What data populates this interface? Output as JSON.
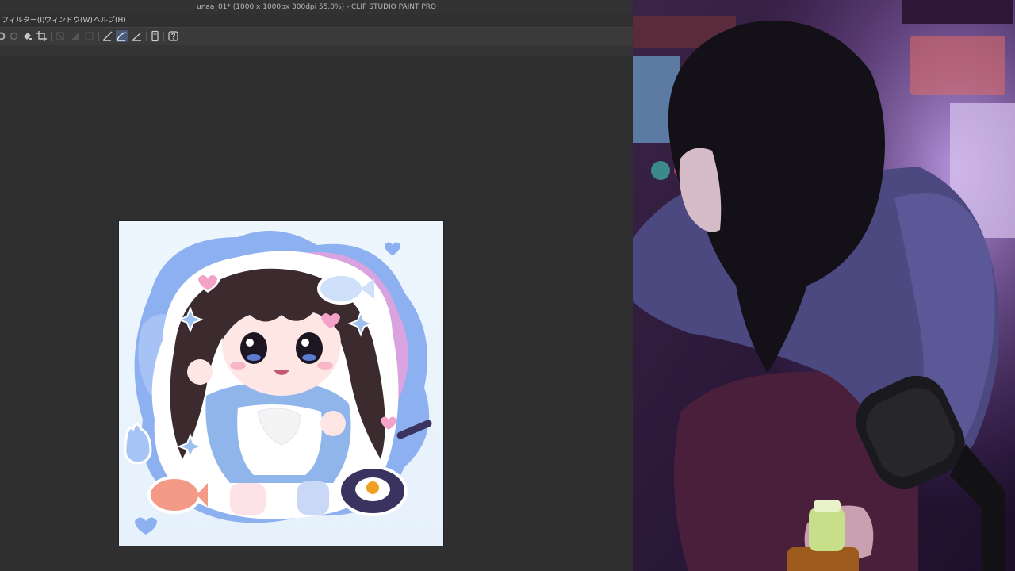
{
  "window": {
    "title": "unaa_01* (1000 x 1000px 300dpi 55.0%)  - CLIP STUDIO PAINT PRO"
  },
  "menu": [
    {
      "label": "フィルター(I)"
    },
    {
      "label": "ウィンドウ(W)"
    },
    {
      "label": "ヘルプ(H)"
    }
  ],
  "toolbar": {
    "icons": [
      "settings-icon",
      "empty-icon",
      "fill-icon",
      "crop-icon",
      "disabled-1-icon",
      "disabled-2-icon",
      "disabled-3-icon",
      "ruler-line-icon",
      "ruler-curve-icon",
      "ruler-angle-icon",
      "device-icon",
      "help-icon"
    ],
    "active": "ruler-curve-icon"
  },
  "canvas": {
    "kind": "chibi illustration",
    "colors": {
      "bg": "#e9f3fd",
      "blob_blue": "#7fa6ee",
      "blob_pink": "#e59ad8",
      "hair": "#3b2a2e",
      "dress": "#8fb5ea"
    }
  },
  "webcam": {
    "colors": {
      "room_light": "#8a5cc8",
      "hoodie": "#4b4980",
      "hair": "#141018",
      "chair": "#4a1f3b"
    }
  }
}
